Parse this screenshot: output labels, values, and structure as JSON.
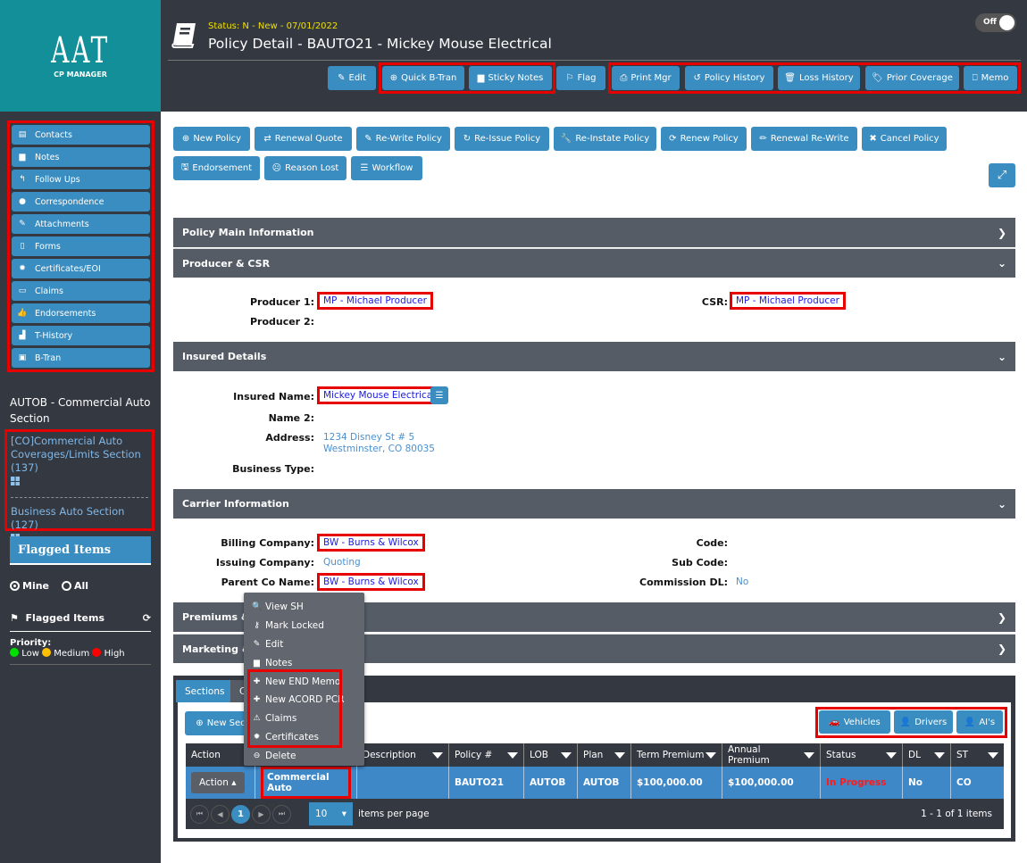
{
  "logo": {
    "big": "AAT",
    "small": "CP MANAGER"
  },
  "header": {
    "status": "Status: N - New - 07/01/2022",
    "title": "Policy Detail - BAUTO21 - Mickey Mouse Electrical",
    "toggle_label": "Off",
    "buttons": [
      {
        "label": "Edit",
        "icon": "edit-icon"
      },
      {
        "label": "Quick B-Tran",
        "icon": "plus-circle-icon"
      },
      {
        "label": "Sticky Notes",
        "icon": "file-icon"
      },
      {
        "label": "Flag",
        "icon": "flag-icon"
      },
      {
        "label": "Print Mgr",
        "icon": "print-icon"
      },
      {
        "label": "Policy History",
        "icon": "history-icon"
      },
      {
        "label": "Loss History",
        "icon": "trash-icon"
      },
      {
        "label": "Prior Coverage",
        "icon": "tags-icon"
      },
      {
        "label": "Memo",
        "icon": "bookmark-icon"
      }
    ]
  },
  "sidebar": {
    "items": [
      {
        "label": "Contacts",
        "icon": "contacts-icon"
      },
      {
        "label": "Notes",
        "icon": "file-icon"
      },
      {
        "label": "Follow Ups",
        "icon": "reply-icon"
      },
      {
        "label": "Correspondence",
        "icon": "comments-icon"
      },
      {
        "label": "Attachments",
        "icon": "paperclip-icon"
      },
      {
        "label": "Forms",
        "icon": "form-icon"
      },
      {
        "label": "Certificates/EOI",
        "icon": "certificate-icon"
      },
      {
        "label": "Claims",
        "icon": "list-icon"
      },
      {
        "label": "Endorsements",
        "icon": "thumbs-up-icon"
      },
      {
        "label": "T-History",
        "icon": "bar-chart-icon"
      },
      {
        "label": "B-Tran",
        "icon": "money-icon"
      }
    ],
    "section_title": "AUTOB - Commercial Auto Section",
    "section_links": [
      "[CO]Commercial Auto Coverages/Limits Section (137)",
      "Business Auto Section (127)"
    ],
    "flagged_header": "Flagged Items",
    "radio_mine": "Mine",
    "radio_all": "All",
    "flagged_label": "Flagged Items",
    "priority_label": "Priority:",
    "priorities": [
      {
        "label": "Low",
        "color": "#00e000"
      },
      {
        "label": "Medium",
        "color": "#ffc000"
      },
      {
        "label": "High",
        "color": "#ff0000"
      }
    ]
  },
  "actions": {
    "row1": [
      {
        "label": "New Policy",
        "icon": "plus-circle-icon"
      },
      {
        "label": "Renewal Quote",
        "icon": "retweet-icon"
      },
      {
        "label": "Re-Write Policy",
        "icon": "pencil-square-icon"
      },
      {
        "label": "Re-Issue Policy",
        "icon": "redo-icon"
      },
      {
        "label": "Re-Instate Policy",
        "icon": "wrench-icon"
      },
      {
        "label": "Renew Policy",
        "icon": "refresh-icon"
      },
      {
        "label": "Renewal Re-Write",
        "icon": "pencil-icon"
      },
      {
        "label": "Cancel Policy",
        "icon": "times-icon"
      }
    ],
    "row2": [
      {
        "label": "Endorsement",
        "icon": "save-icon"
      },
      {
        "label": "Reason Lost",
        "icon": "frown-icon"
      },
      {
        "label": "Workflow",
        "icon": "tasks-icon"
      }
    ]
  },
  "panels": {
    "policy_main": "Policy Main Information",
    "producer_csr": "Producer & CSR",
    "insured_details": "Insured Details",
    "carrier_info": "Carrier Information",
    "premiums": "Premiums &",
    "marketing": "Marketing &"
  },
  "producer": {
    "producer1_label": "Producer 1:",
    "producer1_value": "MP - Michael Producer",
    "producer2_label": "Producer 2:",
    "csr_label": "CSR:",
    "csr_value": "MP - Michael Producer"
  },
  "insured": {
    "name_label": "Insured Name:",
    "name_value": "Mickey Mouse Electrical",
    "name2_label": "Name 2:",
    "address_label": "Address:",
    "address_line1": "1234 Disney St # 5",
    "address_line2": "Westminster, CO 80035",
    "business_type_label": "Business Type:"
  },
  "carrier": {
    "billing_label": "Billing Company:",
    "billing_value": "BW - Burns & Wilcox",
    "issuing_label": "Issuing Company:",
    "issuing_value": "Quoting",
    "parent_label": "Parent Co Name:",
    "parent_value": "BW - Burns & Wilcox",
    "code_label": "Code:",
    "subcode_label": "Sub Code:",
    "commission_label": "Commission DL:",
    "commission_value": "No"
  },
  "sections_tab": {
    "tabs": [
      "Sections",
      "C"
    ],
    "new_section_label": "New Sec",
    "side_buttons": [
      {
        "label": "Vehicles",
        "icon": "car-icon"
      },
      {
        "label": "Drivers",
        "icon": "user-icon"
      },
      {
        "label": "AI's",
        "icon": "user-icon"
      }
    ],
    "columns": [
      "Action",
      "",
      "Description",
      "Policy #",
      "LOB",
      "Plan",
      "Term Premium",
      "Annual Premium",
      "Status",
      "DL",
      "ST"
    ],
    "rows": [
      {
        "action": "Action",
        "name": "Commercial Auto",
        "description": "",
        "policy": "BAUTO21",
        "lob": "AUTOB",
        "plan": "AUTOB",
        "term_premium": "$100,000.00",
        "annual_premium": "$100,000.00",
        "status": "In Progress",
        "dl": "No",
        "st": "CO"
      }
    ],
    "page": "1",
    "per_page": "10",
    "per_page_label": "items per page",
    "count_label": "1 - 1 of 1 items",
    "status_color": "#ff1a1a"
  },
  "context_menu": [
    {
      "label": "View SH",
      "icon": "search-icon"
    },
    {
      "label": "Mark Locked",
      "icon": "key-icon"
    },
    {
      "label": "Edit",
      "icon": "edit-icon"
    },
    {
      "label": "Notes",
      "icon": "file-icon"
    },
    {
      "label": "New END Memo",
      "icon": "plus-icon"
    },
    {
      "label": "New ACORD PCR",
      "icon": "plus-icon"
    },
    {
      "label": "Claims",
      "icon": "warning-icon"
    },
    {
      "label": "Certificates",
      "icon": "certificate-icon"
    },
    {
      "label": "Delete",
      "icon": "minus-circle-icon"
    }
  ]
}
